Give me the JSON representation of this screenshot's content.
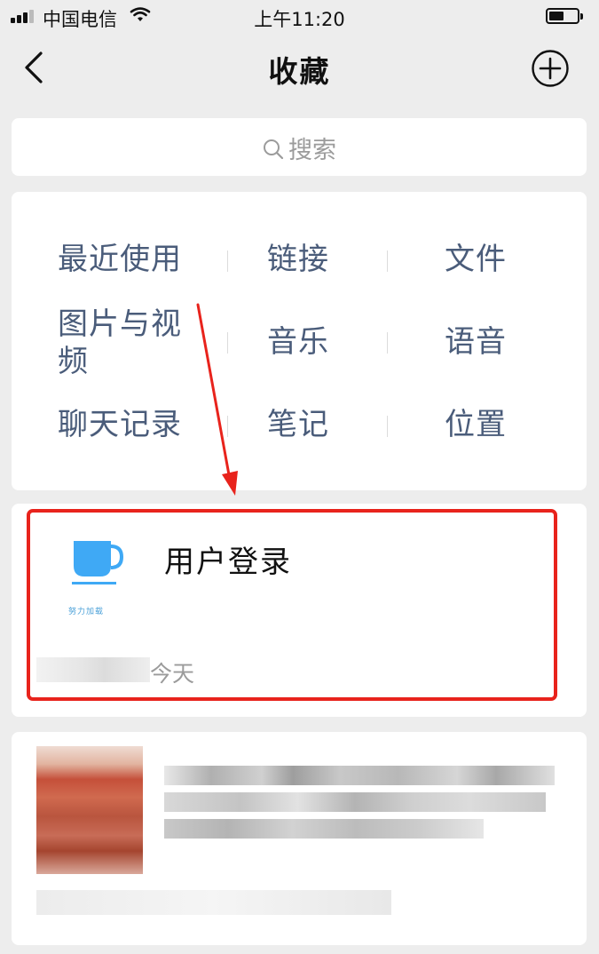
{
  "status_bar": {
    "carrier": "中国电信",
    "time": "上午11:20"
  },
  "nav": {
    "title": "收藏"
  },
  "search": {
    "placeholder": "搜索"
  },
  "categories": [
    {
      "label": "最近使用"
    },
    {
      "label": "链接"
    },
    {
      "label": "文件"
    },
    {
      "label": "图片与视频"
    },
    {
      "label": "音乐"
    },
    {
      "label": "语音"
    },
    {
      "label": "聊天记录"
    },
    {
      "label": "笔记"
    },
    {
      "label": "位置"
    }
  ],
  "favorites": [
    {
      "title": "用户登录",
      "date": "今天",
      "thumb_caption": "努力加载"
    }
  ],
  "colors": {
    "accent_text": "#4a5c7a",
    "highlight": "#e8231c",
    "background": "#ededed"
  }
}
